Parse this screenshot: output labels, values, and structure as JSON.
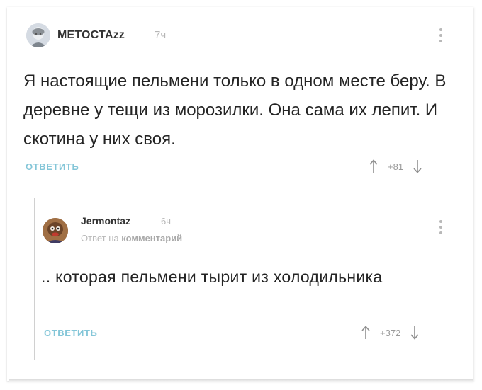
{
  "comments": [
    {
      "author": "МЕТОСТАzz",
      "time": "7ч",
      "text": "Я настоящие пельмени только в одном месте беру. В деревне у тещи из морозилки. Она сама их лепит. И скотина у них своя.",
      "reply_label": "ОТВЕТИТЬ",
      "score": "+81"
    },
    {
      "author": "Jermontaz",
      "time": "6ч",
      "reply_to_prefix": "Ответ на",
      "reply_to_link": "комментарий",
      "text": ".. которая пельмени тырит из холодильника",
      "reply_label": "ОТВЕТИТЬ",
      "score": "+372"
    }
  ],
  "colors": {
    "link": "#84c6d8",
    "muted": "#b6b6b6",
    "thread_line": "#d0d0d0"
  },
  "icons": [
    "avatar-portrait",
    "upvote-arrow",
    "downvote-arrow",
    "more-vertical-dots"
  ]
}
